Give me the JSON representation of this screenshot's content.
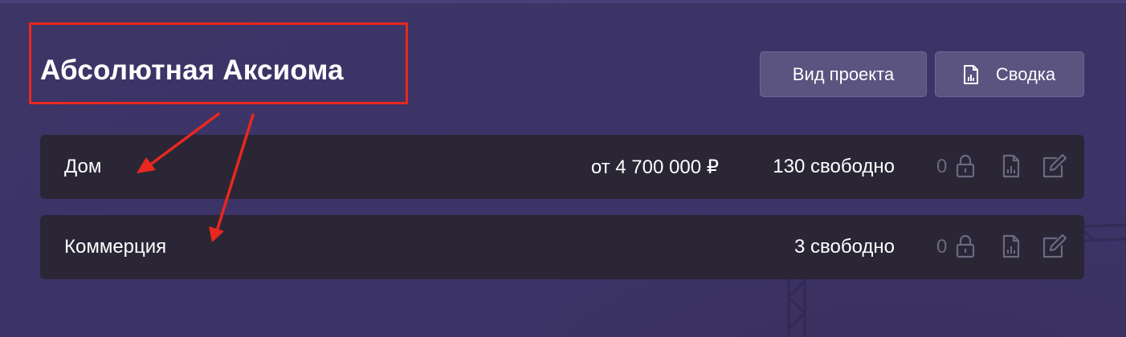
{
  "header": {
    "title": "Абсолютная Аксиома",
    "buttons": {
      "view_project": "Вид проекта",
      "summary": "Сводка",
      "summary_icon": "report-icon"
    }
  },
  "rows": [
    {
      "name": "Дом",
      "price": "от 4 700 000 ₽",
      "free": "130 свободно",
      "locked_count": "0",
      "icons": [
        "lock-icon",
        "report-icon",
        "edit-icon"
      ]
    },
    {
      "name": "Коммерция",
      "price": "",
      "free": "3 свободно",
      "locked_count": "0",
      "icons": [
        "lock-icon",
        "report-icon",
        "edit-icon"
      ]
    }
  ],
  "annotation": {
    "highlight_color": "#e8281e",
    "arrows": 2
  },
  "colors": {
    "background": "#3d3566",
    "row_background": "#2a2636",
    "button_background": "#5b5380",
    "muted_icon": "#6c6880"
  }
}
